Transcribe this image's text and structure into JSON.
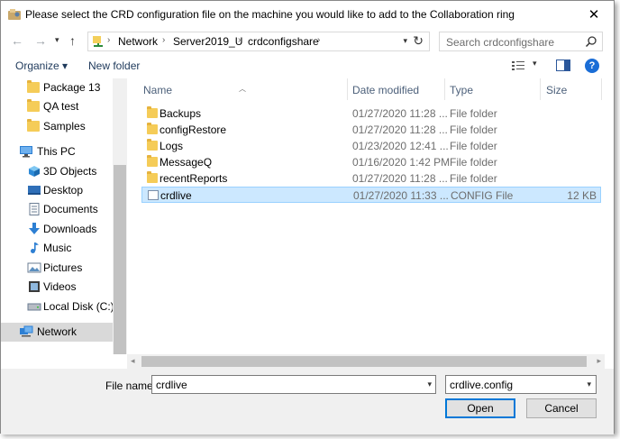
{
  "window": {
    "title": "Please select the CRD configuration file on the machine you would like to add to the Collaboration ring",
    "close_glyph": "✕"
  },
  "navigation": {
    "back_icon": "arrow-left-icon",
    "forward_icon": "arrow-right-icon",
    "recent_icon": "chevron-down-icon",
    "up_icon": "arrow-up-icon",
    "breadcrumbs": [
      "Network",
      "Server2019_U",
      "crdconfigshare"
    ],
    "search_placeholder": "Search crdconfigshare"
  },
  "toolbar": {
    "organize_label": "Organize ▾",
    "new_folder_label": "New folder"
  },
  "sidebar": {
    "items": [
      {
        "label": "Package 13",
        "icon": "folder-icon"
      },
      {
        "label": "QA test",
        "icon": "folder-icon"
      },
      {
        "label": "Samples",
        "icon": "folder-icon"
      },
      {
        "label": "This PC",
        "icon": "computer-icon"
      },
      {
        "label": "3D Objects",
        "icon": "cube-icon"
      },
      {
        "label": "Desktop",
        "icon": "desktop-icon"
      },
      {
        "label": "Documents",
        "icon": "document-icon"
      },
      {
        "label": "Downloads",
        "icon": "download-icon"
      },
      {
        "label": "Music",
        "icon": "music-icon"
      },
      {
        "label": "Pictures",
        "icon": "pictures-icon"
      },
      {
        "label": "Videos",
        "icon": "video-icon"
      },
      {
        "label": "Local Disk (C:)",
        "icon": "disk-icon"
      },
      {
        "label": "Network",
        "icon": "network-icon"
      }
    ],
    "selected": "Network"
  },
  "file_list": {
    "columns": [
      "Name",
      "Date modified",
      "Type",
      "Size"
    ],
    "rows": [
      {
        "name": "Backups",
        "date": "01/27/2020 11:28 ...",
        "type": "File folder",
        "size": ""
      },
      {
        "name": "configRestore",
        "date": "01/27/2020 11:28 ...",
        "type": "File folder",
        "size": ""
      },
      {
        "name": "Logs",
        "date": "01/23/2020 12:41 ...",
        "type": "File folder",
        "size": ""
      },
      {
        "name": "MessageQ",
        "date": "01/16/2020 1:42 PM",
        "type": "File folder",
        "size": ""
      },
      {
        "name": "recentReports",
        "date": "01/27/2020 11:28 ...",
        "type": "File folder",
        "size": ""
      },
      {
        "name": "crdlive",
        "date": "01/27/2020 11:33 ...",
        "type": "CONFIG File",
        "size": "12 KB"
      }
    ],
    "selected_row": "crdlive"
  },
  "footer": {
    "file_name_label": "File name:",
    "file_name_value": "crdlive",
    "file_type_value": "crdlive.config",
    "open_label": "Open",
    "cancel_label": "Cancel"
  },
  "colors": {
    "selection_bg": "#cce8ff",
    "selection_border": "#99d1ff",
    "folder": "#f5cc58",
    "accent": "#0078d7"
  }
}
